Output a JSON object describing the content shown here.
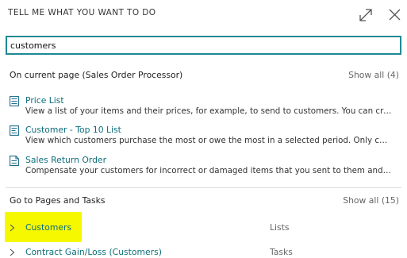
{
  "dialog": {
    "title": "TELL ME WHAT YOU WANT TO DO",
    "expand_icon": "expand-icon",
    "close_icon": "close-icon"
  },
  "search": {
    "value": "customers",
    "placeholder": ""
  },
  "current_page": {
    "header": "On current page (Sales Order Processor)",
    "show_all": "Show all (4)",
    "results": [
      {
        "icon": "list-icon",
        "title": "Price List",
        "description": "View a list of your items and their prices, for example, to send to customers. You can creat..."
      },
      {
        "icon": "report-icon",
        "title": "Customer - Top 10 List",
        "description": "View which customers purchase the most or owe the most in a selected period. Only cust..."
      },
      {
        "icon": "document-icon",
        "title": "Sales Return Order",
        "description": "Compensate your customers for incorrect or damaged items that you sent to them and re..."
      }
    ]
  },
  "pages_tasks": {
    "header": "Go to Pages and Tasks",
    "show_all": "Show all (15)",
    "items": [
      {
        "name": "Customers",
        "category": "Lists"
      },
      {
        "name": "Contract Gain/Loss (Customers)",
        "category": "Tasks"
      }
    ]
  },
  "colors": {
    "accent": "#1f8a94",
    "link": "#0d6e7a",
    "highlight": "#f6f800"
  }
}
